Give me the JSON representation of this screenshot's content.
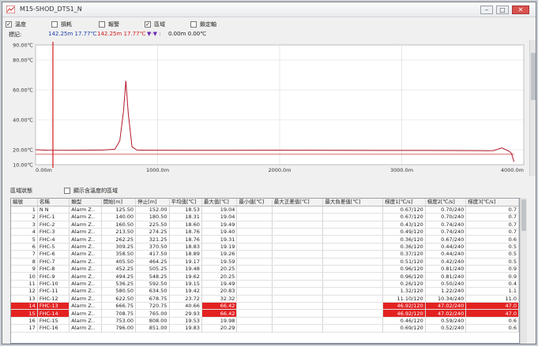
{
  "window": {
    "title": "M15-SHOD_DTS1_N"
  },
  "toolbar": {
    "items": [
      {
        "label": "溫度",
        "checked": true
      },
      {
        "label": "損耗",
        "checked": false
      },
      {
        "label": "報警",
        "checked": false
      },
      {
        "label": "區域",
        "checked": true
      },
      {
        "label": "鎖定軸",
        "checked": false
      }
    ]
  },
  "readout": {
    "label": "標記:",
    "marker1": "142.25m 17.77℃",
    "marker2": "142.25m 17.77℃",
    "delta": "0.00m 0.00℃",
    "delta_glyph": "▼·▼ :"
  },
  "chart_data": {
    "type": "line",
    "xlim": [
      0,
      4000
    ],
    "ylim": [
      10,
      90
    ],
    "xticks": [
      "0.00m",
      "1000.0m",
      "2000.0m",
      "3000.0m",
      "4000.0m"
    ],
    "yticks": [
      "90.00℃",
      "80.00℃",
      "60.00℃",
      "40.00℃",
      "20.00℃",
      "10.00℃"
    ],
    "marker_x": 142.25,
    "threshold": 17,
    "series": [
      {
        "x": [
          0,
          100,
          300,
          550,
          650,
          690,
          720,
          740,
          760,
          790,
          830,
          900,
          1200,
          1600,
          2000,
          2400,
          2800,
          3200,
          3600,
          3700,
          3750,
          3820,
          3880,
          3900,
          3920
        ],
        "y": [
          20,
          19.7,
          19.6,
          19.8,
          20.3,
          26,
          45,
          66,
          44,
          22,
          19.8,
          19.7,
          19.6,
          19.6,
          19.7,
          19.6,
          19.5,
          19.5,
          19.4,
          19.3,
          19.4,
          21.2,
          19,
          17.5,
          12
        ]
      }
    ],
    "colors": {
      "series": "#b5172b",
      "marker": "#d41b1b",
      "threshold": "#d85a5a"
    }
  },
  "segments": {
    "label": "區域狀態",
    "option_label": "顯示含溫度的區域",
    "columns": [
      "編號",
      "名稱",
      "類型",
      "開始[m]",
      "停止[m]",
      "平均值[℃]",
      "最大值[℃]",
      "最小值[℃]",
      "最大正差值[℃]",
      "最大負差值[℃]",
      "梯度1[℃/s]",
      "梯度2[℃/s]",
      "梯度3[℃/s]"
    ],
    "rows": [
      [
        "1",
        "N N",
        "Alarm Z..",
        "125.50",
        "152.00",
        "18.53",
        "19.04",
        "",
        "",
        "",
        "0.67/120",
        "0.70/240",
        "0.7"
      ],
      [
        "2",
        "FHC-1",
        "Alarm Z..",
        "140.00",
        "180.50",
        "18.31",
        "19.04",
        "",
        "",
        "",
        "0.67/120",
        "0.70/240",
        "0.7"
      ],
      [
        "3",
        "FHC-2",
        "Alarm Z..",
        "160.50",
        "225.50",
        "18.60",
        "19.49",
        "",
        "",
        "",
        "0.43/120",
        "0.74/240",
        "0.7"
      ],
      [
        "4",
        "FHC-3",
        "Alarm Z..",
        "213.50",
        "274.25",
        "18.76",
        "19.40",
        "",
        "",
        "",
        "0.49/120",
        "0.74/240",
        "0.7"
      ],
      [
        "5",
        "FHC-4",
        "Alarm Z..",
        "262.25",
        "321.25",
        "18.76",
        "19.31",
        "",
        "",
        "",
        "0.36/120",
        "0.67/240",
        "0.6"
      ],
      [
        "6",
        "FHC-5",
        "Alarm Z..",
        "309.25",
        "370.50",
        "18.83",
        "19.19",
        "",
        "",
        "",
        "0.36/120",
        "0.44/240",
        "0.5"
      ],
      [
        "7",
        "FHC-6",
        "Alarm Z..",
        "358.50",
        "417.50",
        "18.89",
        "19.26",
        "",
        "",
        "",
        "0.37/120",
        "0.44/240",
        "0.5"
      ],
      [
        "8",
        "FHC-7",
        "Alarm Z..",
        "405.50",
        "464.25",
        "19.17",
        "19.59",
        "",
        "",
        "",
        "0.51/120",
        "0.42/240",
        "0.5"
      ],
      [
        "9",
        "FHC-8",
        "Alarm Z..",
        "452.25",
        "505.25",
        "19.48",
        "20.25",
        "",
        "",
        "",
        "0.96/120",
        "0.81/240",
        "0.9"
      ],
      [
        "10",
        "FHC-9",
        "Alarm Z..",
        "494.25",
        "548.25",
        "19.62",
        "20.25",
        "",
        "",
        "",
        "0.96/120",
        "0.81/240",
        "0.9"
      ],
      [
        "11",
        "FHC-10",
        "Alarm Z..",
        "536.25",
        "592.50",
        "19.15",
        "19.49",
        "",
        "",
        "",
        "0.26/120",
        "0.50/240",
        "0.4"
      ],
      [
        "12",
        "FHC-11",
        "Alarm Z..",
        "580.50",
        "634.50",
        "19.42",
        "20.83",
        "",
        "",
        "",
        "1.32/120",
        "1.22/240",
        "1.1"
      ],
      [
        "13",
        "FHC-12",
        "Alarm Z..",
        "622.50",
        "678.75",
        "23.72",
        "32.32",
        "",
        "",
        "",
        "11.10/120",
        "10.34/240",
        "11.0"
      ],
      [
        "14",
        "FHC-13",
        "Alarm Z..",
        "666.75",
        "720.75",
        "40.66",
        "66.42",
        "",
        "",
        "",
        "46.92/120",
        "47.02/240",
        "47.0"
      ],
      [
        "15",
        "FHC-14",
        "Alarm Z..",
        "708.75",
        "765.00",
        "29.93",
        "66.42",
        "",
        "",
        "",
        "46.92/120",
        "47.02/240",
        "47.0"
      ],
      [
        "16",
        "FHC-15",
        "Alarm Z..",
        "753.00",
        "808.00",
        "19.53",
        "19.98",
        "",
        "",
        "",
        "0.46/120",
        "0.59/240",
        "0.6"
      ],
      [
        "17",
        "FHC-16",
        "Alarm Z..",
        "796.00",
        "851.00",
        "19.83",
        "20.29",
        "",
        "",
        "",
        "0.69/120",
        "0.52/240",
        "0.6"
      ]
    ],
    "highlight_rows": [
      13,
      14
    ]
  }
}
